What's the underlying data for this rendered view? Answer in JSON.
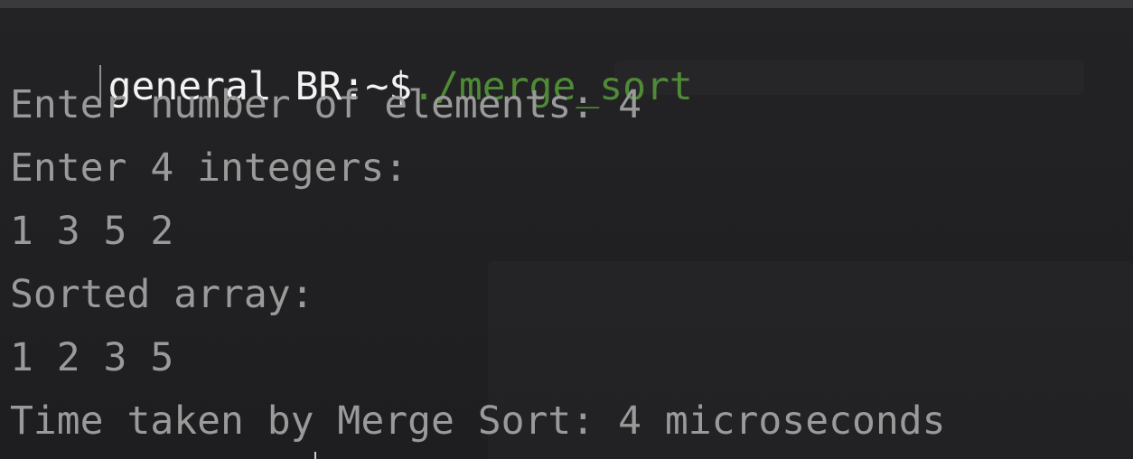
{
  "terminal": {
    "prompt": {
      "host": "general BR:~$",
      "command": "./merge_sort"
    },
    "output": [
      "Enter number of elements: 4",
      "Enter 4 integers:",
      "1 3 5 2",
      "Sorted array:",
      "1 2 3 5",
      "Time taken by Merge Sort: 4 microseconds"
    ]
  },
  "colors": {
    "background": "#1f1f21",
    "prompt_text": "#f2f2f2",
    "command_text": "#4f8b36",
    "output_text": "#9a9a9a"
  }
}
